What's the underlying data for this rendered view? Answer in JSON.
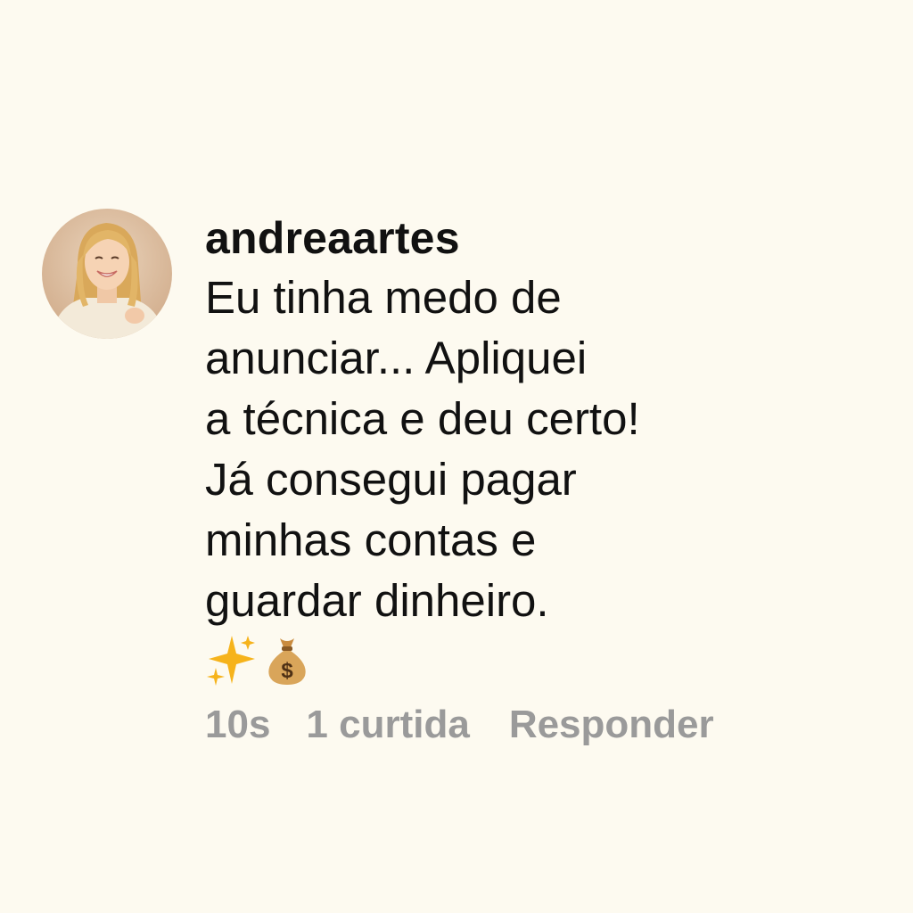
{
  "comment": {
    "avatar_icon": "user-photo-avatar",
    "username": "andreaartes",
    "message_lines": [
      "Eu tinha medo de",
      "anunciar... Apliquei",
      "a técnica e deu certo!",
      "Já consegui pagar",
      "minhas contas e",
      "guardar dinheiro."
    ],
    "emojis": [
      "sparkles-icon",
      "money-bag-icon"
    ],
    "meta": {
      "time": "10s",
      "likes": "1 curtida",
      "reply": "Responder"
    }
  },
  "colors": {
    "background": "#fdfaf0",
    "text": "#111111",
    "meta": "#9a9a9a",
    "avatar_bg": "#d8b89a"
  }
}
